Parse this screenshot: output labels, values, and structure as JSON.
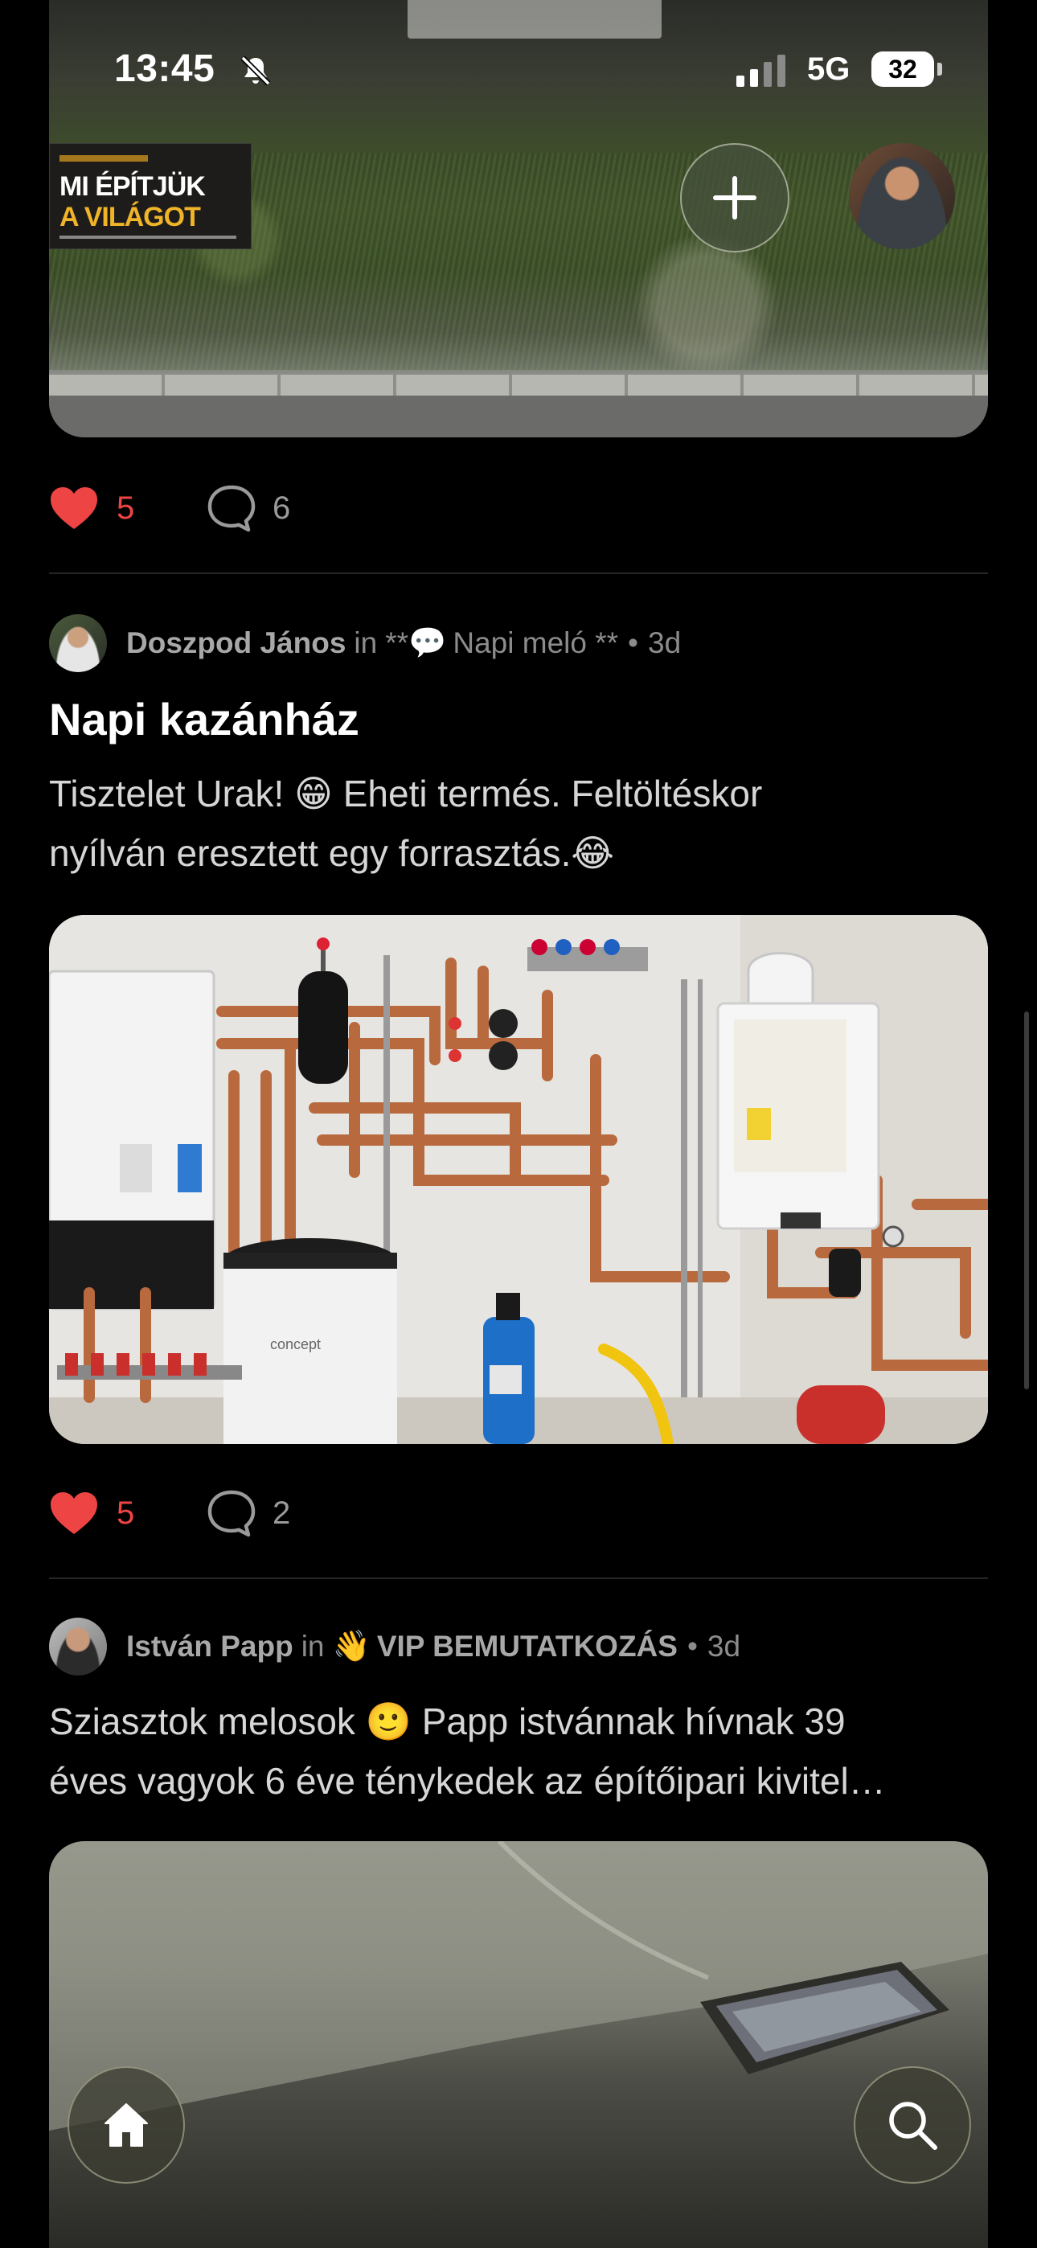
{
  "status_bar": {
    "time": "13:45",
    "network": "5G",
    "battery": "32",
    "battery_level": 0.32
  },
  "header": {
    "community_logo": {
      "line1": "MI ÉPÍTJÜK",
      "line2": "A VILÁGOT"
    },
    "add_icon": "plus-icon",
    "profile_icon": "avatar"
  },
  "posts": [
    {
      "likes": "5",
      "comments": "6"
    },
    {
      "author": "Doszpod János",
      "in": "in",
      "category_prefix": "**",
      "category_icon": "💬",
      "category": "Napi meló **",
      "dot": "•",
      "age": "3d",
      "title": "Napi kazánház",
      "body_line1": "Tisztelet Urak! 😁 Eheti termés. Feltöltéskor",
      "body_line2": "nyílván eresztett egy forrasztás.😂",
      "image_brand": "concept",
      "likes": "5",
      "comments": "2"
    },
    {
      "author": "István Papp",
      "in": "in",
      "category_icon": "👋",
      "category": "VIP BEMUTATKOZÁS",
      "dot": "•",
      "age": "3d",
      "body_line1": "Sziasztok melosok 🙂  Papp istvánnak hívnak 39",
      "body_line2": "éves vagyok 6 éve ténykedek az építőipari kivitel…"
    }
  ],
  "bottom_nav": {
    "home_icon": "home-icon",
    "search_icon": "search-icon"
  },
  "colors": {
    "background": "#000000",
    "like_red": "#ef4444",
    "muted_text": "#8c8c8c"
  }
}
